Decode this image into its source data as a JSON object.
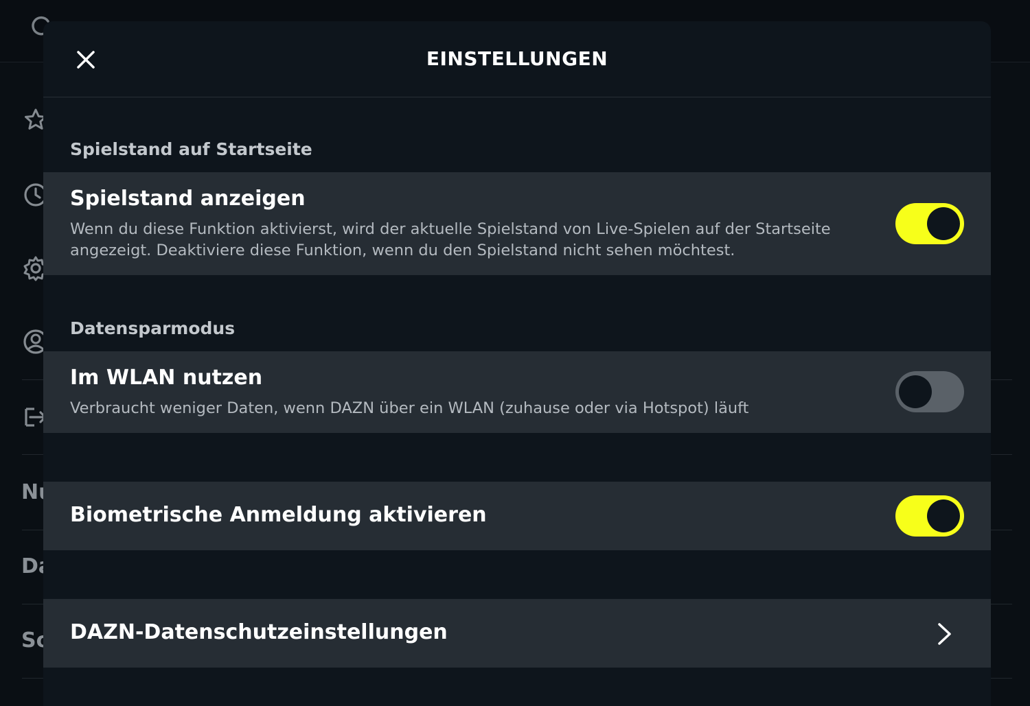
{
  "background": {
    "sidebar_text_fragments": [
      "Nu",
      "Da",
      "So"
    ],
    "sidebar_icons": [
      "star-icon",
      "clock-icon",
      "gear-icon",
      "account-icon",
      "sign-in-icon"
    ]
  },
  "modal": {
    "title": "EINSTELLUNGEN",
    "close_icon": "close-icon",
    "sections": {
      "score": {
        "label": "Spielstand auf Startseite",
        "row": {
          "title": "Spielstand anzeigen",
          "description": "Wenn du diese Funktion aktivierst, wird der aktuelle Spielstand von Live-Spielen auf der Startseite angezeigt. Deaktiviere diese Funktion, wenn du den Spielstand nicht sehen möchtest.",
          "enabled": true
        }
      },
      "data_saver": {
        "label": "Datensparmodus",
        "row": {
          "title": "Im WLAN nutzen",
          "description": "Verbraucht weniger Daten, wenn DAZN über ein WLAN (zuhause oder via Hotspot) läuft",
          "enabled": false
        }
      },
      "biometric": {
        "row": {
          "title": "Biometrische Anmeldung aktivieren",
          "enabled": true
        }
      },
      "privacy": {
        "row": {
          "title": "DAZN-Datenschutzeinstellungen",
          "icon": "chevron-right-icon"
        }
      }
    }
  },
  "colors": {
    "accent": "#f7ff1a",
    "modal_bg": "#0e151c",
    "row_bg": "#262d34",
    "toggle_off": "#5a6168"
  }
}
